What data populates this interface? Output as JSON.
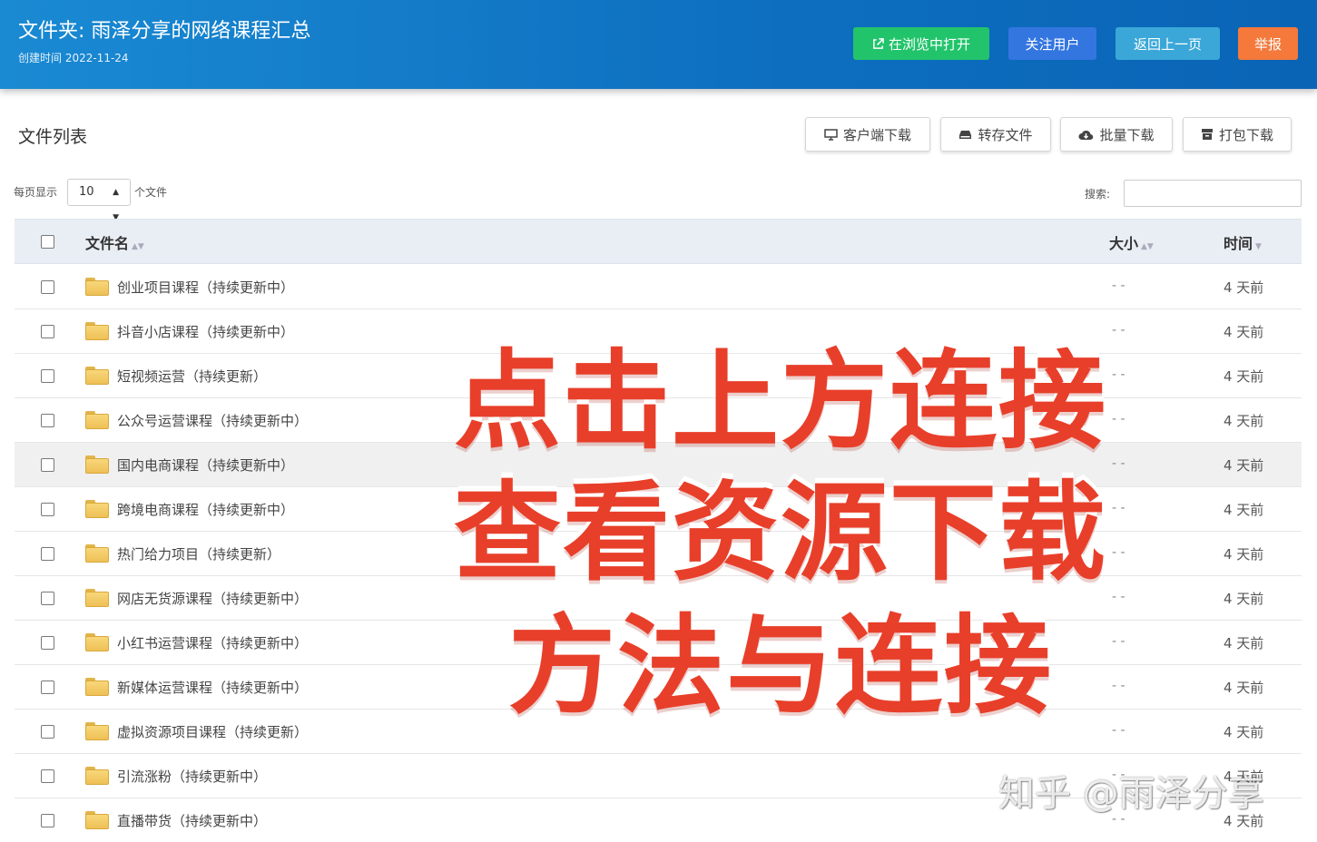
{
  "header": {
    "title": "文件夹: 雨泽分享的网络课程汇总",
    "created": "创建时间 2022-11-24",
    "buttons": {
      "open_browser": "在浏览中打开",
      "follow_user": "关注用户",
      "go_back": "返回上一页",
      "report": "举报"
    }
  },
  "toolbar": {
    "list_title": "文件列表",
    "client_download": "客户端下载",
    "save_files": "转存文件",
    "batch_download": "批量下载",
    "pack_download": "打包下载"
  },
  "controls": {
    "per_page_label": "每页显示",
    "per_page_value": "10",
    "per_page_suffix": "个文件",
    "search_label": "搜索:",
    "search_value": ""
  },
  "table": {
    "headers": {
      "name": "文件名",
      "size": "大小",
      "time": "时间"
    },
    "rows": [
      {
        "name": "创业项目课程（持续更新中）",
        "size": "- -",
        "time": "4 天前"
      },
      {
        "name": "抖音小店课程（持续更新中）",
        "size": "- -",
        "time": "4 天前"
      },
      {
        "name": "短视频运营（持续更新）",
        "size": "- -",
        "time": "4 天前"
      },
      {
        "name": "公众号运营课程（持续更新中）",
        "size": "- -",
        "time": "4 天前"
      },
      {
        "name": "国内电商课程（持续更新中）",
        "size": "- -",
        "time": "4 天前"
      },
      {
        "name": "跨境电商课程（持续更新中）",
        "size": "- -",
        "time": "4 天前"
      },
      {
        "name": "热门给力项目（持续更新）",
        "size": "- -",
        "time": "4 天前"
      },
      {
        "name": "网店无货源课程（持续更新中）",
        "size": "- -",
        "time": "4 天前"
      },
      {
        "name": "小红书运营课程（持续更新中）",
        "size": "- -",
        "time": "4 天前"
      },
      {
        "name": "新媒体运营课程（持续更新中）",
        "size": "- -",
        "time": "4 天前"
      },
      {
        "name": "虚拟资源项目课程（持续更新）",
        "size": "- -",
        "time": "4 天前"
      },
      {
        "name": "引流涨粉（持续更新中）",
        "size": "- -",
        "time": "4 天前"
      },
      {
        "name": "直播带货（持续更新中）",
        "size": "- -",
        "time": "4 天前"
      }
    ]
  },
  "overlay": {
    "line1": "点击上方连接",
    "line2": "查看资源下载",
    "line3": "方法与连接",
    "watermark": "知乎 @雨泽分享"
  },
  "colors": {
    "header_bg": "#0d6ebf",
    "btn_green": "#22c46b",
    "btn_blue": "#3476e0",
    "btn_cyan": "#3aa7d8",
    "btn_orange": "#f4793b",
    "overlay_red": "#e83f2a"
  }
}
